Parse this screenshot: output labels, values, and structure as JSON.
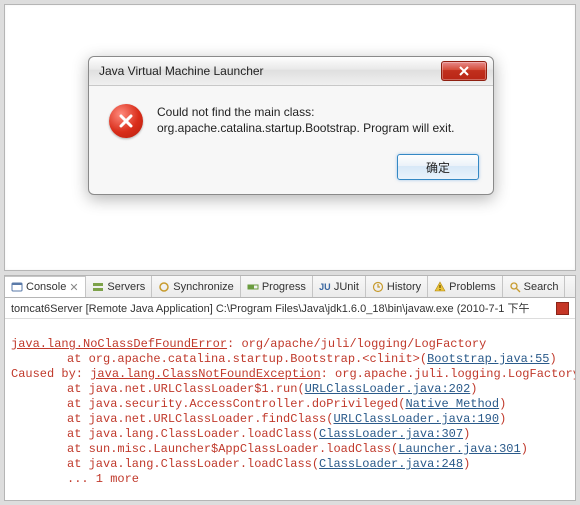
{
  "dialog": {
    "title": "Java Virtual Machine Launcher",
    "line1": "Could not find the main class:",
    "line2": "org.apache.catalina.startup.Bootstrap.  Program will exit.",
    "ok_label": "确定"
  },
  "tabs": {
    "console": "Console",
    "servers": "Servers",
    "synchronize": "Synchronize",
    "progress": "Progress",
    "junit": "JUnit",
    "history": "History",
    "problems": "Problems",
    "search": "Search"
  },
  "console_header": "tomcat6Server [Remote Java Application] C:\\Program Files\\Java\\jdk1.6.0_18\\bin\\javaw.exe (2010-7-1 下午",
  "trace": {
    "l1a": "java.lang.NoClassDefFoundError",
    "l1b": ": org/apache/juli/logging/LogFactory",
    "l2a": "at org.apache.catalina.startup.Bootstrap.<clinit>(",
    "l2b": "Bootstrap.java:55",
    "l2c": ")",
    "l3a": "Caused by: ",
    "l3b": "java.lang.ClassNotFoundException",
    "l3c": ": org.apache.juli.logging.LogFactory",
    "l4a": "at java.net.URLClassLoader$1.run(",
    "l4b": "URLClassLoader.java:202",
    "l4c": ")",
    "l5a": "at java.security.AccessController.doPrivileged(",
    "l5b": "Native Method",
    "l5c": ")",
    "l6a": "at java.net.URLClassLoader.findClass(",
    "l6b": "URLClassLoader.java:190",
    "l6c": ")",
    "l7a": "at java.lang.ClassLoader.loadClass(",
    "l7b": "ClassLoader.java:307",
    "l7c": ")",
    "l8a": "at sun.misc.Launcher$AppClassLoader.loadClass(",
    "l8b": "Launcher.java:301",
    "l8c": ")",
    "l9a": "at java.lang.ClassLoader.loadClass(",
    "l9b": "ClassLoader.java:248",
    "l9c": ")",
    "l10": "... 1 more"
  }
}
